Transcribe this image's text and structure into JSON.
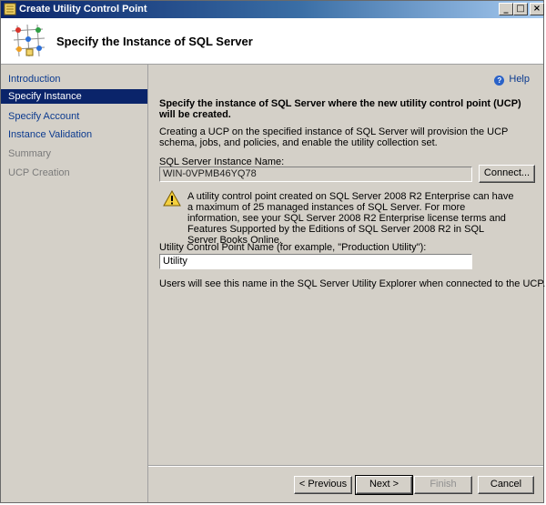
{
  "window": {
    "title": "Create Utility Control Point",
    "title_bar_colors": {
      "start": "#0a246a",
      "end": "#a6caf0"
    },
    "controls": {
      "minimize": "_",
      "maximize": "□",
      "close": "×"
    }
  },
  "header": {
    "title": "Specify the Instance of SQL Server",
    "logo_icon": "utility-wizard-icon"
  },
  "sidebar": {
    "items": [
      {
        "label": "Introduction",
        "state": "normal"
      },
      {
        "label": "Specify Instance",
        "state": "selected"
      },
      {
        "label": "Specify Account",
        "state": "normal"
      },
      {
        "label": "Instance Validation",
        "state": "normal"
      },
      {
        "label": "Summary",
        "state": "disabled"
      },
      {
        "label": "UCP Creation",
        "state": "disabled"
      }
    ]
  },
  "content": {
    "help_label": "Help",
    "heading": "Specify the instance of SQL Server where the new utility control point (UCP) will be created.",
    "description": "Creating a UCP on the specified instance of SQL Server will provision the UCP schema, jobs, and policies, and enable the utility collection set.",
    "instance_label": "SQL Server Instance Name:",
    "instance_value": "WIN-0VPMB46YQ78",
    "connect_label": "Connect...",
    "warning_icon": "warning-icon",
    "warning_text": "A utility control point created on SQL Server 2008 R2 Enterprise can have a maximum of 25 managed instances of SQL Server. For more information, see your SQL Server 2008 R2 Enterprise license terms and Features Supported by the Editions of SQL Server 2008 R2 in SQL Server Books Online.",
    "ucp_name_label": "Utility Control Point Name (for example, \"Production Utility\"):",
    "ucp_name_value": "Utility",
    "note": "Users will see this name in the SQL Server Utility Explorer when connected to the UCP."
  },
  "footer": {
    "previous_label": "< Previous",
    "next_label": "Next >",
    "finish_label": "Finish",
    "cancel_label": "Cancel"
  },
  "colors": {
    "selected_nav_bg": "#0a246a",
    "link_text": "#0b3a8f",
    "disabled_text": "#7a7a7a",
    "dialog_bg": "#d4d0c8"
  }
}
